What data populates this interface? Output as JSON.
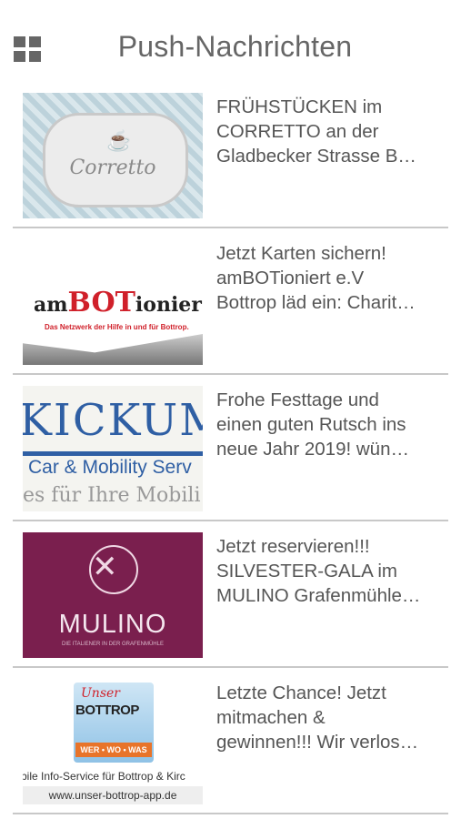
{
  "header": {
    "title": "Push-Nachrichten",
    "menu_icon": "grid-menu-icon"
  },
  "items": [
    {
      "title": "FRÜHSTÜCKEN im CORRETTO an der Gladbecker Strasse B…",
      "lines": [
        "FRÜHSTÜCKEN im",
        "CORRETTO an der",
        "Gladbecker Strasse B…"
      ],
      "thumb_text": "Corretto"
    },
    {
      "title": "Jetzt Karten sichern! amBOTioniert e.V Bottrop läd ein: Charit…",
      "lines": [
        "Jetzt Karten sichern!",
        "amBOTioniert e.V",
        "Bottrop läd ein: Charit…"
      ],
      "thumb_text_a": "am",
      "thumb_text_b": "BOT",
      "thumb_text_c": "ionier",
      "thumb_sub": "Das Netzwerk der Hilfe in und für Bottrop."
    },
    {
      "title": "Frohe Festtage und einen guten Rutsch ins neue Jahr 2019! wün…",
      "lines": [
        "Frohe Festtage und",
        "einen guten Rutsch ins",
        "neue Jahr 2019! wün…"
      ],
      "thumb_big": "KICKUM",
      "thumb_mid": "Car & Mobility Serv",
      "thumb_low": "es für Ihre Mobili"
    },
    {
      "title": "Jetzt reservieren!!! SILVESTER-GALA im MULINO Grafenmühle…",
      "lines": [
        "Jetzt reservieren!!!",
        "SILVESTER-GALA im",
        "MULINO Grafenmühle…"
      ],
      "thumb_name": "MULINO",
      "thumb_tag": "DIE ITALIENER IN DER GRAFENMÜHLE"
    },
    {
      "title": "Letzte Chance! Jetzt mitmachen & gewinnen!!! Wir verlos…",
      "lines": [
        "Letzte Chance! Jetzt",
        "mitmachen &",
        "gewinnen!!! Wir verlos…"
      ],
      "thumb_unser": "Unser",
      "thumb_bottrop": "BOTTROP",
      "thumb_www": "WER • WO • WAS",
      "thumb_info": "bile Info-Service für Bottrop & Kirc",
      "thumb_url": "www.unser-bottrop-app.de"
    }
  ],
  "colors": {
    "text": "#555555",
    "separator": "#c8c8c8",
    "mulino": "#7a1f4e",
    "kickum_blue": "#2f5fa4",
    "ambot_red": "#d0202a"
  }
}
